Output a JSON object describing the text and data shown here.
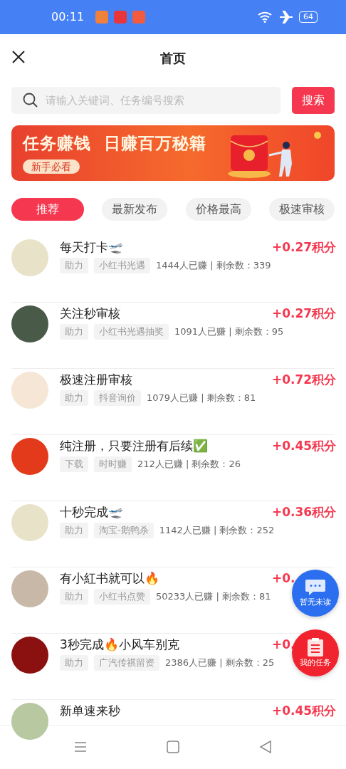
{
  "status_bar": {
    "time": "00:11",
    "battery": "64"
  },
  "header": {
    "title": "首页"
  },
  "search": {
    "placeholder": "请输入关键词、任务编号搜索",
    "button": "搜索"
  },
  "banner": {
    "title": "任务赚钱  日赚百万秘籍",
    "badge": "新手必看"
  },
  "tabs": [
    {
      "label": "推荐",
      "selected": true
    },
    {
      "label": "最新发布",
      "selected": false
    },
    {
      "label": "价格最高",
      "selected": false
    },
    {
      "label": "极速审核",
      "selected": false
    }
  ],
  "tasks": [
    {
      "title": "每天打卡🛫",
      "reward": "+0.27积分",
      "tags": [
        "助力",
        "小红书光遇"
      ],
      "stats": "1444人已赚 | 剩余数：339"
    },
    {
      "title": "关注秒审核",
      "reward": "+0.27积分",
      "tags": [
        "助力",
        "小红书光遇抽奖"
      ],
      "stats": "1091人已赚 | 剩余数：95"
    },
    {
      "title": "极速注册审核",
      "reward": "+0.72积分",
      "tags": [
        "助力",
        "抖音询价"
      ],
      "stats": "1079人已赚 | 剩余数：81"
    },
    {
      "title": "纯注册，只要注册有后续✅",
      "reward": "+0.45积分",
      "tags": [
        "下载",
        "时时赚"
      ],
      "stats": "212人已赚 | 剩余数：26"
    },
    {
      "title": "十秒完成🛫",
      "reward": "+0.36积分",
      "tags": [
        "助力",
        "淘宝-鹅鸭杀"
      ],
      "stats": "1142人已赚 | 剩余数：252"
    },
    {
      "title": "有小紅书就可以🔥",
      "reward": "+0.",
      "tags": [
        "助力",
        "小红书点赞"
      ],
      "stats": "50233人已赚 | 剩余数：81"
    },
    {
      "title": "3秒完成🔥小风车别克",
      "reward": "+0.",
      "tags": [
        "助力",
        "广汽传祺留资"
      ],
      "stats": "2386人已赚 | 剩余数：25"
    },
    {
      "title": "新单速来秒",
      "reward": "+0.45积分"
    }
  ],
  "floating_buttons": [
    {
      "label": "暂无未读",
      "kind": "message"
    },
    {
      "label": "我的任务",
      "kind": "tasks"
    }
  ]
}
